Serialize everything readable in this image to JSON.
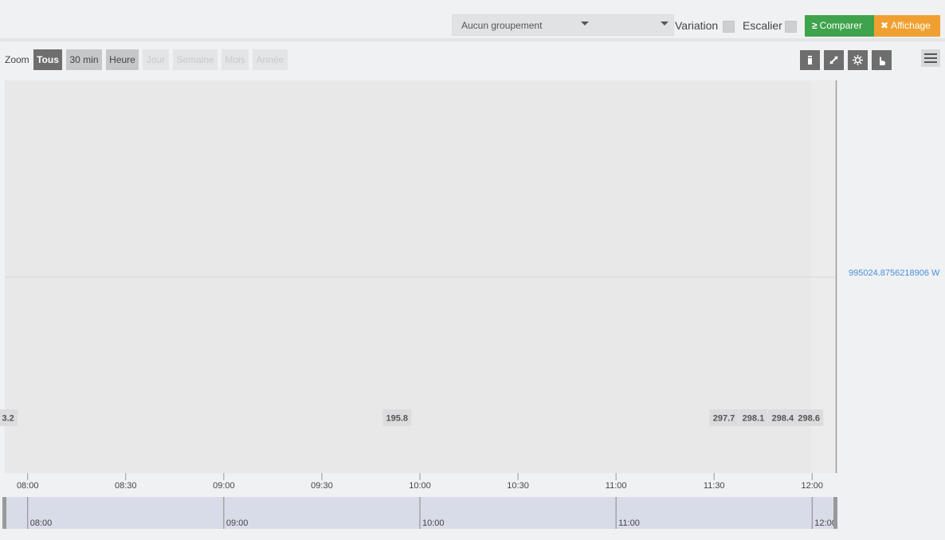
{
  "toolbar": {
    "grouping_select": "Aucun groupement",
    "variation_label": "Variation",
    "staircase_label": "Escalier",
    "compare_icon": "≥",
    "compare_label": "Comparer",
    "display_icon": "✖",
    "display_label": "Affichage",
    "compare_color": "#3fa34d",
    "display_color": "#f0a030"
  },
  "zoom": {
    "label": "Zoom",
    "buttons": [
      {
        "label": "Tous",
        "state": "active"
      },
      {
        "label": "30 min",
        "state": "enabled"
      },
      {
        "label": "Heure",
        "state": "enabled"
      },
      {
        "label": "Jour",
        "state": "disabled"
      },
      {
        "label": "Semaine",
        "state": "disabled"
      },
      {
        "label": "Mois",
        "state": "disabled"
      },
      {
        "label": "Année",
        "state": "disabled"
      }
    ]
  },
  "tools": [
    {
      "icon": "calendar-icon"
    },
    {
      "icon": "expand-icon"
    },
    {
      "icon": "settings-icon"
    },
    {
      "icon": "pointer-hand-icon"
    }
  ],
  "menu_icon": "hamburger-menu-icon",
  "chart_data": {
    "type": "line",
    "x_ticks": [
      "08:00",
      "08:30",
      "09:00",
      "09:30",
      "10:00",
      "10:30",
      "11:00",
      "11:30",
      "12:00"
    ],
    "navigator_ticks": [
      "08:00",
      "09:00",
      "10:00",
      "11:00",
      "12:00"
    ],
    "x_range": [
      "07:53",
      "12:07"
    ],
    "y_marker": {
      "label": "995024.8756218906 W",
      "color": "#4a90d9"
    },
    "grid": "one horizontal line",
    "data_labels": [
      {
        "x": "07:54",
        "label": "3.2"
      },
      {
        "x": "09:53",
        "label": "195.8"
      },
      {
        "x": "11:33",
        "label": "297.7"
      },
      {
        "x": "11:42",
        "label": "298.1"
      },
      {
        "x": "11:51",
        "label": "298.4"
      },
      {
        "x": "11:59",
        "label": "298.6"
      }
    ]
  }
}
